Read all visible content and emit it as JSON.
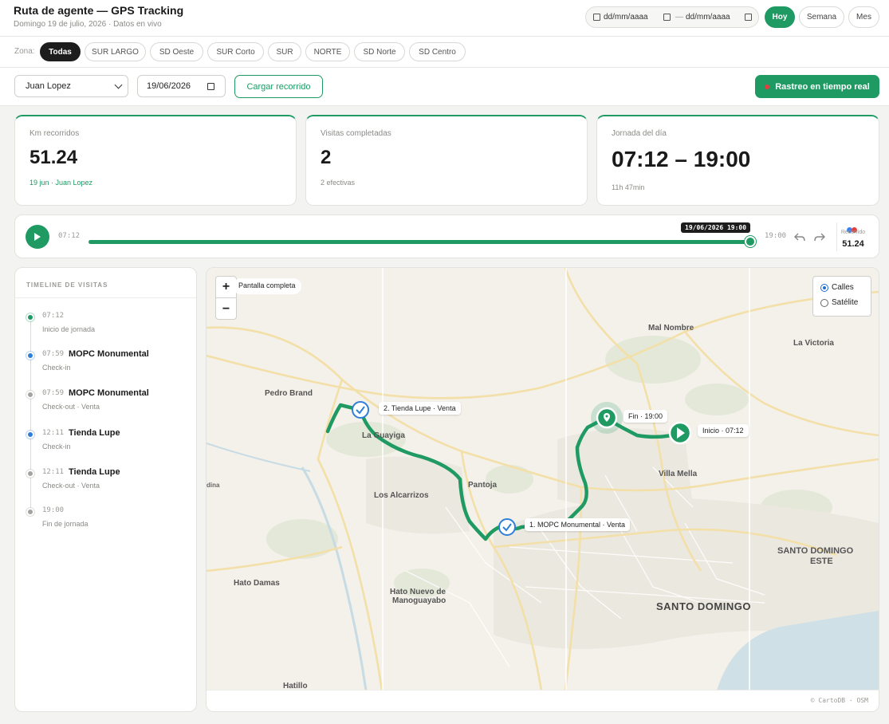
{
  "header": {
    "title": "Ruta de agente — GPS Tracking",
    "subtitle": "Domingo 19 de julio, 2026 · Datos en vivo",
    "date_from_placeholder": "dd/mm/aaaa",
    "date_to_placeholder": "dd/mm/aaaa",
    "date_separator": "—",
    "btn_today": "Hoy",
    "btn_week": "Semana",
    "btn_month": "Mes"
  },
  "zones": {
    "label": "Zona:",
    "items": [
      "Todas",
      "SUR LARGO",
      "SD Oeste",
      "SUR Corto",
      "SUR",
      "NORTE",
      "SD Norte",
      "SD Centro"
    ],
    "active": "Todas"
  },
  "controls": {
    "agent": "Juan Lopez",
    "date": "19/06/2026",
    "load_button": "Cargar recorrido",
    "live_button": "Rastreo en tiempo real"
  },
  "stats": {
    "km": {
      "label": "Km recorridos",
      "value": "51.24",
      "sub": "19 jun · Juan Lopez"
    },
    "visits": {
      "label": "Visitas completadas",
      "value": "2",
      "sub": "2 efectivas"
    },
    "day": {
      "label": "Jornada del día",
      "value": "07:12 – 19:00",
      "sub": "11h 47min"
    }
  },
  "player": {
    "start": "07:12",
    "end": "19:00",
    "tooltip": "19/06/2026 19:00",
    "progress": 1.0,
    "recorded_label": "Recorrido",
    "recorded_value": "51.24"
  },
  "timeline": {
    "heading": "TIMELINE DE VISITAS",
    "items": [
      {
        "time": "07:12",
        "title": "",
        "note": "Inicio de jornada",
        "color": "#1f9a63"
      },
      {
        "time": "07:59",
        "title": "MOPC Monumental",
        "note": "Check-in",
        "color": "#2f7fd8"
      },
      {
        "time": "07:59",
        "title": "MOPC Monumental",
        "note": "Check-out · Venta",
        "color": "#a3a3a0"
      },
      {
        "time": "12:11",
        "title": "Tienda Lupe",
        "note": "Check-in",
        "color": "#2f7fd8"
      },
      {
        "time": "12:11",
        "title": "Tienda Lupe",
        "note": "Check-out · Venta",
        "color": "#a3a3a0"
      },
      {
        "time": "19:00",
        "title": "",
        "note": "Fin de jornada",
        "color": "#a3a3a0"
      }
    ]
  },
  "map": {
    "zoom_in": "+",
    "zoom_out": "−",
    "fullscreen": "Pantalla completa",
    "layer_streets": "Calles",
    "layer_satellite": "Satélite",
    "layer_selected": "Calles",
    "labels": {
      "mal_nombre": "Mal Nombre",
      "la_victoria": "La Victoria",
      "pedro_brand": "Pedro Brand",
      "la_guayiga": "La Guayiga",
      "pantoja": "Pantoja",
      "los_alcarrizos": "Los Alcarrizos",
      "villa_mella": "Villa Mella",
      "dina": "dina",
      "hato_damas": "Hato Damas",
      "hato_nuevo_1": "Hato Nuevo de",
      "hato_nuevo_2": "Manoguayabo",
      "santo_domingo": "SANTO DOMINGO",
      "sde_1": "SANTO DOMINGO",
      "sde_2": "ESTE",
      "hatillo": "Hatillo"
    },
    "markers": {
      "visit2": "2. Tienda Lupe · Venta",
      "visit1": "1. MOPC Monumental · Venta",
      "end": "Fin · 19:00",
      "start": "Inicio · 07:12"
    },
    "attribution": "© CartoDB · OSM",
    "route_color": "#1f9a63"
  }
}
